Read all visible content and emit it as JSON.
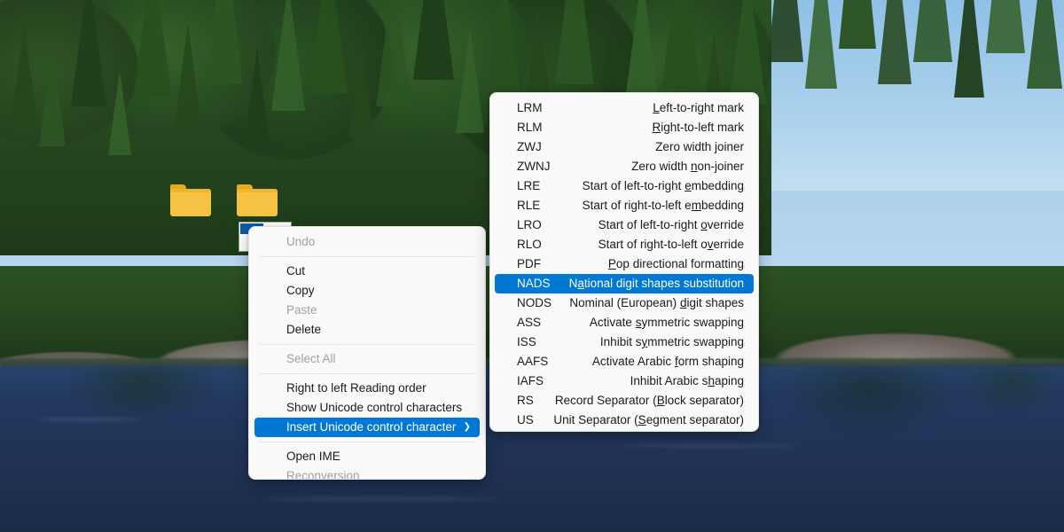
{
  "desktop": {
    "wallpaper_description": "Mountain lake with conifer forest reflection",
    "colors": {
      "sky": "#a9d0ec",
      "forest": "#2b5223",
      "lake": "#213559",
      "rock": "#7e7a72"
    },
    "icons": [
      {
        "name": "folder-icon-1",
        "type": "folder",
        "color": "#f5c243"
      },
      {
        "name": "folder-icon-2",
        "type": "folder",
        "color": "#f5c243"
      }
    ],
    "rename_field": {
      "value": "",
      "placeholder": ""
    }
  },
  "accent_color": "#0078d4",
  "context_menu": {
    "items": [
      {
        "label": "Undo",
        "state": "disabled"
      },
      {
        "type": "separator"
      },
      {
        "label": "Cut",
        "state": "normal"
      },
      {
        "label": "Copy",
        "state": "normal"
      },
      {
        "label": "Paste",
        "state": "disabled"
      },
      {
        "label": "Delete",
        "state": "normal"
      },
      {
        "type": "separator"
      },
      {
        "label": "Select All",
        "state": "disabled"
      },
      {
        "type": "separator"
      },
      {
        "label": "Right to left Reading order",
        "state": "normal"
      },
      {
        "label": "Show Unicode control characters",
        "state": "normal"
      },
      {
        "label": "Insert Unicode control character",
        "state": "selected",
        "submenu": true,
        "chevron": "❯"
      },
      {
        "type": "separator"
      },
      {
        "label": "Open IME",
        "state": "normal"
      },
      {
        "label": "Reconversion",
        "state": "disabled"
      }
    ]
  },
  "submenu": {
    "title": "Insert Unicode control character",
    "items": [
      {
        "abbr": "LRM",
        "desc_pre": "",
        "accel": "L",
        "desc_post": "eft-to-right mark",
        "state": "normal"
      },
      {
        "abbr": "RLM",
        "desc_pre": "",
        "accel": "R",
        "desc_post": "ight-to-left mark",
        "state": "normal"
      },
      {
        "abbr": "ZWJ",
        "desc_pre": "Zero width ",
        "accel": "j",
        "desc_post": "oiner",
        "state": "normal"
      },
      {
        "abbr": "ZWNJ",
        "desc_pre": "Zero width ",
        "accel": "n",
        "desc_post": "on-joiner",
        "state": "normal"
      },
      {
        "abbr": "LRE",
        "desc_pre": "Start of left-to-right ",
        "accel": "e",
        "desc_post": "mbedding",
        "state": "normal"
      },
      {
        "abbr": "RLE",
        "desc_pre": "Start of right-to-left e",
        "accel": "m",
        "desc_post": "bedding",
        "state": "normal"
      },
      {
        "abbr": "LRO",
        "desc_pre": "Start of left-to-right ",
        "accel": "o",
        "desc_post": "verride",
        "state": "normal"
      },
      {
        "abbr": "RLO",
        "desc_pre": "Start of right-to-left o",
        "accel": "v",
        "desc_post": "erride",
        "state": "normal"
      },
      {
        "abbr": "PDF",
        "desc_pre": "",
        "accel": "P",
        "desc_post": "op directional formatting",
        "state": "normal"
      },
      {
        "abbr": "NADS",
        "desc_pre": "N",
        "accel": "a",
        "desc_post": "tional digit shapes substitution",
        "state": "selected"
      },
      {
        "abbr": "NODS",
        "desc_pre": "Nominal (European) ",
        "accel": "d",
        "desc_post": "igit shapes",
        "state": "normal"
      },
      {
        "abbr": "ASS",
        "desc_pre": "Activate ",
        "accel": "s",
        "desc_post": "ymmetric swapping",
        "state": "normal"
      },
      {
        "abbr": "ISS",
        "desc_pre": "Inhibit s",
        "accel": "y",
        "desc_post": "mmetric swapping",
        "state": "normal"
      },
      {
        "abbr": "AAFS",
        "desc_pre": "Activate Arabic ",
        "accel": "f",
        "desc_post": "orm shaping",
        "state": "normal"
      },
      {
        "abbr": "IAFS",
        "desc_pre": "Inhibit Arabic s",
        "accel": "h",
        "desc_post": "aping",
        "state": "normal"
      },
      {
        "abbr": "RS",
        "desc_pre": "Record Separator (",
        "accel": "B",
        "desc_post": "lock separator)",
        "state": "normal"
      },
      {
        "abbr": "US",
        "desc_pre": "Unit Separator (",
        "accel": "S",
        "desc_post": "egment separator)",
        "state": "normal"
      }
    ]
  }
}
